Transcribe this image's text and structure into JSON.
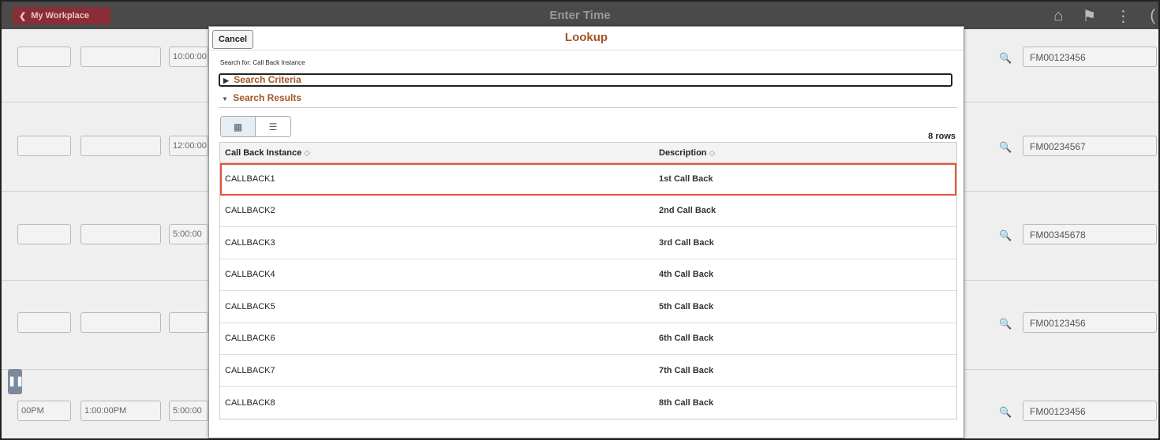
{
  "header": {
    "back_label": "My Workplace",
    "title": "Enter Time",
    "icons": [
      "home-icon",
      "flag-icon",
      "more-icon"
    ]
  },
  "background": {
    "rows": [
      {
        "time_in": "",
        "time_out": "10:00:00",
        "code": "FM00123456"
      },
      {
        "time_in": "",
        "time_out": "12:00:00",
        "code": "FM00234567"
      },
      {
        "time_in": "",
        "time_out": "5:00:00",
        "code": "FM00345678"
      },
      {
        "time_in": "",
        "time_out": "",
        "code": "FM00123456"
      },
      {
        "time_in": "00PM",
        "time_mid": "1:00:00PM",
        "time_out": "5:00:00",
        "code": "FM00123456"
      }
    ]
  },
  "modal": {
    "cancel_label": "Cancel",
    "title": "Lookup",
    "search_for": "Search for:  Call Back Instance",
    "search_criteria_label": "Search Criteria",
    "search_results_label": "Search Results",
    "rows_count": "8 rows",
    "columns": [
      "Call Back Instance",
      "Description"
    ],
    "results": [
      {
        "instance": "CALLBACK1",
        "description": "1st Call Back"
      },
      {
        "instance": "CALLBACK2",
        "description": "2nd Call Back"
      },
      {
        "instance": "CALLBACK3",
        "description": "3rd Call Back"
      },
      {
        "instance": "CALLBACK4",
        "description": "4th Call Back"
      },
      {
        "instance": "CALLBACK5",
        "description": "5th Call Back"
      },
      {
        "instance": "CALLBACK6",
        "description": "6th Call Back"
      },
      {
        "instance": "CALLBACK7",
        "description": "7th Call Back"
      },
      {
        "instance": "CALLBACK8",
        "description": "8th Call Back"
      }
    ],
    "highlighted_row": 0
  },
  "colors": {
    "accent": "#a35424",
    "highlight": "#e5533c",
    "back_button": "#8b2d34"
  }
}
